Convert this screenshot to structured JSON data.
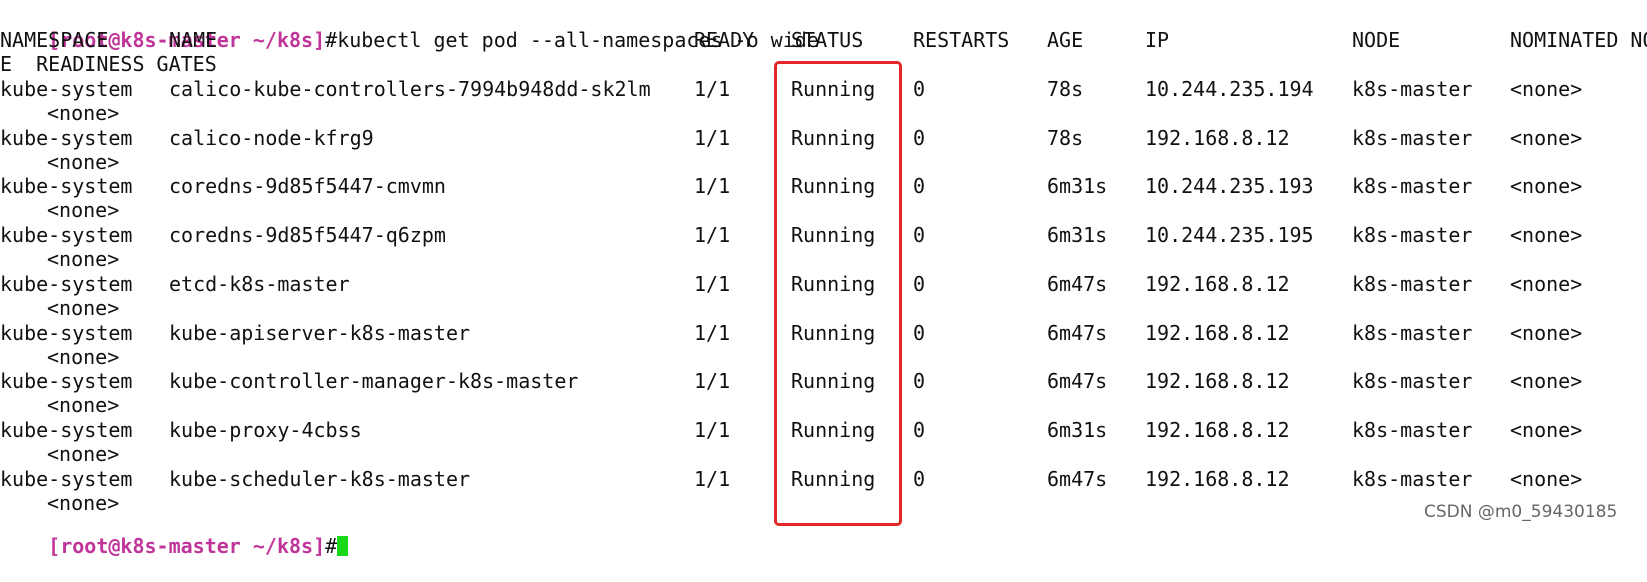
{
  "prompt": {
    "open_bracket": "[",
    "user_host": "root@k8s-master",
    "path": " ~/k8s",
    "close_bracket": "]",
    "hash": "#",
    "command": "kubectl get pod --all-namespaces -o wide"
  },
  "table": {
    "headers": [
      "NAMESPACE",
      "NAME",
      "READY",
      "STATUS",
      "RESTARTS",
      "AGE",
      "IP",
      "NODE",
      "NOMINATED NO"
    ],
    "header_wrap": "E  READINESS GATES",
    "rows": [
      {
        "namespace": "kube-system",
        "name": "calico-kube-controllers-7994b948dd-sk2lm",
        "ready": "1/1",
        "status": "Running",
        "restarts": "0",
        "age": "78s",
        "ip": "10.244.235.194",
        "node": "k8s-master",
        "nominated": "<none>",
        "readiness": "<none>"
      },
      {
        "namespace": "kube-system",
        "name": "calico-node-kfrg9",
        "ready": "1/1",
        "status": "Running",
        "restarts": "0",
        "age": "78s",
        "ip": "192.168.8.12",
        "node": "k8s-master",
        "nominated": "<none>",
        "readiness": "<none>"
      },
      {
        "namespace": "kube-system",
        "name": "coredns-9d85f5447-cmvmn",
        "ready": "1/1",
        "status": "Running",
        "restarts": "0",
        "age": "6m31s",
        "ip": "10.244.235.193",
        "node": "k8s-master",
        "nominated": "<none>",
        "readiness": "<none>"
      },
      {
        "namespace": "kube-system",
        "name": "coredns-9d85f5447-q6zpm",
        "ready": "1/1",
        "status": "Running",
        "restarts": "0",
        "age": "6m31s",
        "ip": "10.244.235.195",
        "node": "k8s-master",
        "nominated": "<none>",
        "readiness": "<none>"
      },
      {
        "namespace": "kube-system",
        "name": "etcd-k8s-master",
        "ready": "1/1",
        "status": "Running",
        "restarts": "0",
        "age": "6m47s",
        "ip": "192.168.8.12",
        "node": "k8s-master",
        "nominated": "<none>",
        "readiness": "<none>"
      },
      {
        "namespace": "kube-system",
        "name": "kube-apiserver-k8s-master",
        "ready": "1/1",
        "status": "Running",
        "restarts": "0",
        "age": "6m47s",
        "ip": "192.168.8.12",
        "node": "k8s-master",
        "nominated": "<none>",
        "readiness": "<none>"
      },
      {
        "namespace": "kube-system",
        "name": "kube-controller-manager-k8s-master",
        "ready": "1/1",
        "status": "Running",
        "restarts": "0",
        "age": "6m47s",
        "ip": "192.168.8.12",
        "node": "k8s-master",
        "nominated": "<none>",
        "readiness": "<none>"
      },
      {
        "namespace": "kube-system",
        "name": "kube-proxy-4cbss",
        "ready": "1/1",
        "status": "Running",
        "restarts": "0",
        "age": "6m31s",
        "ip": "192.168.8.12",
        "node": "k8s-master",
        "nominated": "<none>",
        "readiness": "<none>"
      },
      {
        "namespace": "kube-system",
        "name": "kube-scheduler-k8s-master",
        "ready": "1/1",
        "status": "Running",
        "restarts": "0",
        "age": "6m47s",
        "ip": "192.168.8.12",
        "node": "k8s-master",
        "nominated": "<none>",
        "readiness": "<none>"
      }
    ]
  },
  "watermark": "CSDN @m0_59430185",
  "colors": {
    "prompt": "#c0359a",
    "cursor": "#19d81a",
    "highlight_box": "#e2262a"
  }
}
